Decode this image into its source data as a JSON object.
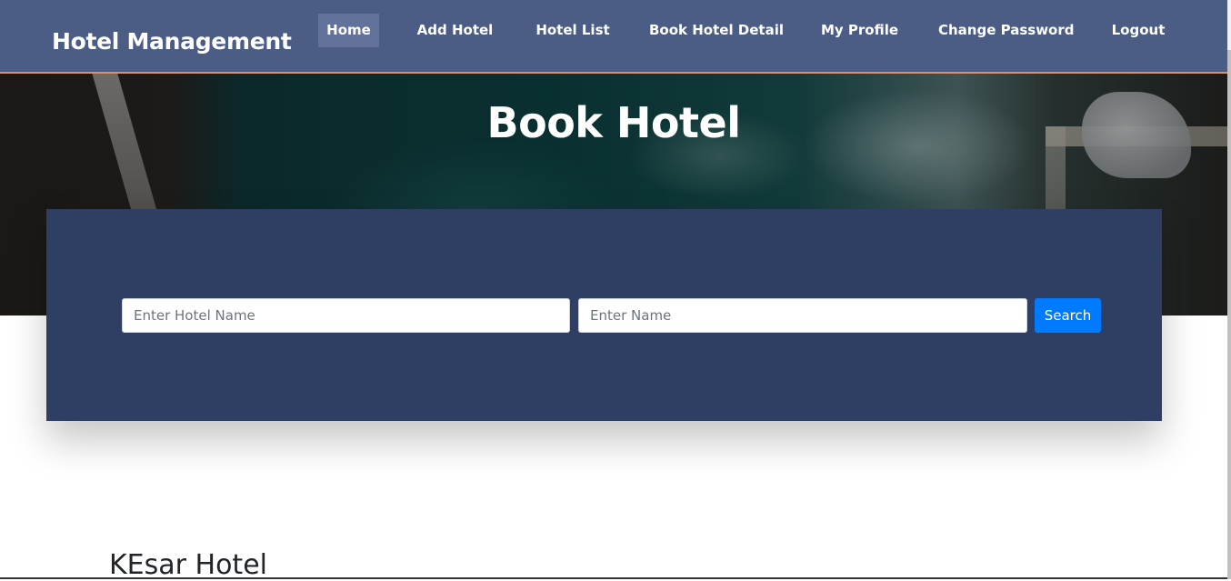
{
  "brand": "Hotel Management",
  "nav": {
    "items": [
      {
        "label": "Home",
        "active": true
      },
      {
        "label": "Add Hotel",
        "active": false
      },
      {
        "label": "Hotel List",
        "active": false
      },
      {
        "label": "Book Hotel Detail",
        "active": false
      },
      {
        "label": "My Profile",
        "active": false
      },
      {
        "label": "Change Password",
        "active": false
      },
      {
        "label": "Logout",
        "active": false
      }
    ]
  },
  "hero": {
    "title": "Book Hotel"
  },
  "search": {
    "hotel_placeholder": "Enter Hotel Name",
    "name_placeholder": "Enter Name",
    "button_label": "Search"
  },
  "results": {
    "first_hotel": "KEsar Hotel"
  },
  "colors": {
    "navbar": "#4c5d85",
    "nav_active": "#62729a",
    "navbar_border": "#d4916c",
    "search_panel": "#2f3e63",
    "primary_button": "#007bff"
  }
}
